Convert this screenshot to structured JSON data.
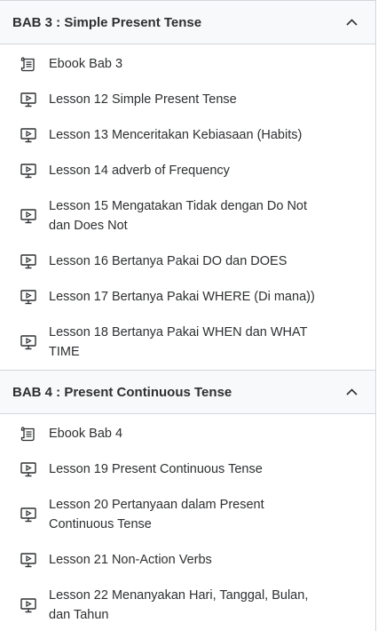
{
  "sections": [
    {
      "title": "BAB 3 : Simple Present Tense",
      "expanded": true,
      "items": [
        {
          "type": "ebook",
          "icon": "ebook-icon",
          "label": "Ebook Bab 3"
        },
        {
          "type": "video",
          "icon": "video-lesson-icon",
          "label": "Lesson 12 Simple Present Tense"
        },
        {
          "type": "video",
          "icon": "video-lesson-icon",
          "label": "Lesson 13 Menceritakan Kebiasaan (Habits)"
        },
        {
          "type": "video",
          "icon": "video-lesson-icon",
          "label": "Lesson 14 adverb of Frequency"
        },
        {
          "type": "video",
          "icon": "video-lesson-icon",
          "label": "Lesson 15 Mengatakan Tidak dengan Do Not dan Does Not"
        },
        {
          "type": "video",
          "icon": "video-lesson-icon",
          "label": "Lesson 16 Bertanya Pakai DO dan DOES"
        },
        {
          "type": "video",
          "icon": "video-lesson-icon",
          "label": "Lesson 17 Bertanya Pakai WHERE (Di mana))"
        },
        {
          "type": "video",
          "icon": "video-lesson-icon",
          "label": "Lesson 18 Bertanya Pakai WHEN dan WHAT TIME"
        }
      ]
    },
    {
      "title": "BAB 4 : Present Continuous Tense",
      "expanded": true,
      "items": [
        {
          "type": "ebook",
          "icon": "ebook-icon",
          "label": "Ebook Bab 4"
        },
        {
          "type": "video",
          "icon": "video-lesson-icon",
          "label": "Lesson 19 Present Continuous Tense"
        },
        {
          "type": "video",
          "icon": "video-lesson-icon",
          "label": "Lesson 20 Pertanyaan dalam Present Continuous Tense"
        },
        {
          "type": "video",
          "icon": "video-lesson-icon",
          "label": "Lesson 21 Non-Action Verbs"
        },
        {
          "type": "video",
          "icon": "video-lesson-icon",
          "label": "Lesson 22 Menanyakan Hari, Tanggal, Bulan, dan Tahun"
        }
      ]
    }
  ],
  "colors": {
    "header_bg": "#f7f9fa",
    "border": "#d1d7dc",
    "text": "#2d2f31"
  }
}
